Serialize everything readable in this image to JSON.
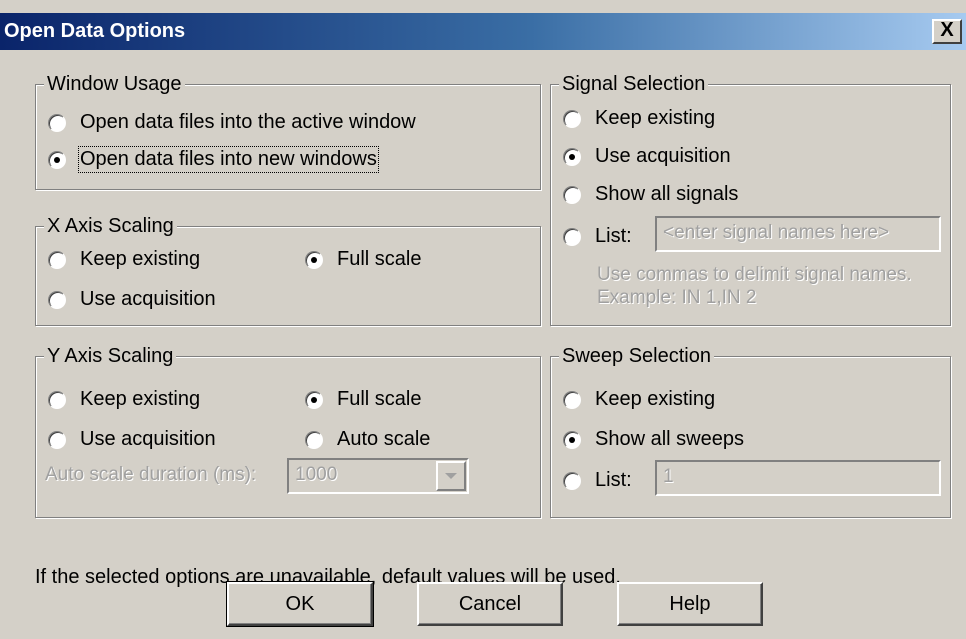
{
  "window": {
    "title": "Open Data Options",
    "close_glyph": "X"
  },
  "window_usage": {
    "legend": "Window Usage",
    "options": [
      {
        "label": "Open data files into the active window",
        "selected": false
      },
      {
        "label": "Open data files into new windows",
        "selected": true
      }
    ]
  },
  "x_axis": {
    "legend": "X Axis Scaling",
    "options": [
      {
        "label": "Keep existing",
        "selected": false
      },
      {
        "label": "Full scale",
        "selected": true
      },
      {
        "label": "Use acquisition",
        "selected": false
      }
    ]
  },
  "y_axis": {
    "legend": "Y Axis Scaling",
    "options": [
      {
        "label": "Keep existing",
        "selected": false
      },
      {
        "label": "Full scale",
        "selected": true
      },
      {
        "label": "Use acquisition",
        "selected": false
      },
      {
        "label": "Auto scale",
        "selected": false
      }
    ],
    "duration_label": "Auto scale duration (ms):",
    "duration_value": "1000"
  },
  "signal": {
    "legend": "Signal Selection",
    "options": [
      {
        "label": "Keep existing",
        "selected": false
      },
      {
        "label": "Use acquisition",
        "selected": true
      },
      {
        "label": "Show all signals",
        "selected": false
      },
      {
        "label": "List:",
        "selected": false
      }
    ],
    "list_placeholder": "<enter signal names here>",
    "hint_line1": "Use commas to delimit signal names.",
    "hint_line2": "Example: IN 1,IN 2"
  },
  "sweep": {
    "legend": "Sweep Selection",
    "options": [
      {
        "label": "Keep existing",
        "selected": false
      },
      {
        "label": "Show all sweeps",
        "selected": true
      },
      {
        "label": "List:",
        "selected": false
      }
    ],
    "list_value": "1"
  },
  "footer_note": "If the selected options are unavailable, default values will be used.",
  "buttons": {
    "ok": "OK",
    "cancel": "Cancel",
    "help": "Help"
  }
}
